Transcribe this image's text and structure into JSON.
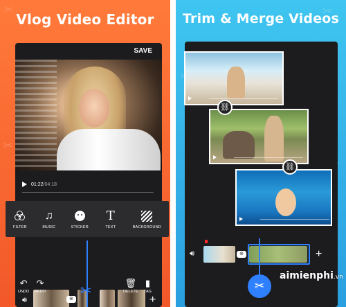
{
  "left_panel": {
    "title": "Vlog Video Editor",
    "save_label": "SAVE",
    "time_current": "01:22",
    "time_separator": "/",
    "time_total": "04:18",
    "tools": [
      {
        "label": "FILTER",
        "icon": "filter-icon"
      },
      {
        "label": "MUSIC",
        "icon": "music-note-icon"
      },
      {
        "label": "STICKER",
        "icon": "sticker-icon"
      },
      {
        "label": "TEXT",
        "icon": "text-icon"
      },
      {
        "label": "BACKGROUND",
        "icon": "background-icon"
      }
    ],
    "music_glyph": "♫",
    "text_glyph": "T",
    "actions": {
      "undo": "UNDO",
      "redo": "REDO",
      "delete": "DELETE",
      "tag": "TAG"
    }
  },
  "right_panel": {
    "title": "Trim & Merge Videos"
  },
  "watermark": {
    "name": "aimienphi",
    "tld": ".vn"
  },
  "colors": {
    "left_bg": "#f2582a",
    "right_bg": "#2a9fe0",
    "accent": "#2f80ff",
    "screen_bg": "#1c1c1e"
  }
}
